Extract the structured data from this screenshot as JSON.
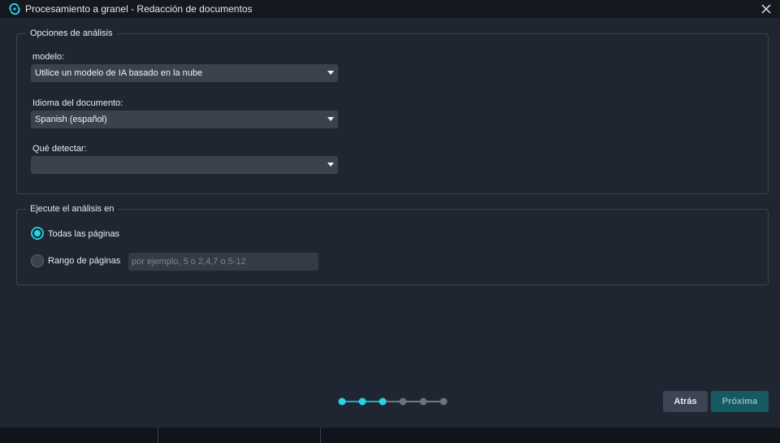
{
  "window": {
    "title": "Procesamiento a granel - Redacción de documentos"
  },
  "analysis_options": {
    "legend": "Opciones de análisis",
    "model": {
      "label": "modelo:",
      "value": "Utilice un modelo de IA basado en la nube"
    },
    "language": {
      "label": "Idioma del documento:",
      "value": "Spanish (español)"
    },
    "detect": {
      "label": "Qué detectar:",
      "value": ""
    }
  },
  "run_on": {
    "legend": "Ejecute el análisis en",
    "all_pages": {
      "label": "Todas las páginas",
      "selected": true
    },
    "page_range": {
      "label": "Rango de páginas",
      "selected": false,
      "placeholder": "por ejemplo, 5 o 2,4,7 o 5-12",
      "value": ""
    }
  },
  "wizard": {
    "total_steps": 6,
    "completed_steps": 3
  },
  "buttons": {
    "back": "Atrás",
    "next": "Próxima"
  },
  "colors": {
    "accent": "#26d4e6",
    "background": "#202631",
    "titlebar": "#141920",
    "next_button": "#155a62"
  },
  "icons": {
    "app": "refresh-cycle-icon",
    "close": "close-icon",
    "dropdown": "chevron-down-icon"
  }
}
